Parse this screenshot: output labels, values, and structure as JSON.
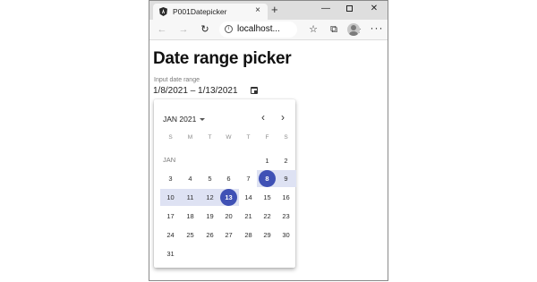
{
  "browser": {
    "tab_title": "P001Datepicker",
    "tab_close": "×",
    "new_tab": "+",
    "address": "localhost...",
    "icons": [
      "angular-icon",
      "back-icon",
      "forward-icon",
      "reload-icon",
      "info-icon",
      "star-icon",
      "favorites-icon",
      "collections-icon",
      "profile-icon",
      "more-icon",
      "minimize-icon",
      "maximize-icon",
      "close-icon"
    ]
  },
  "page": {
    "title": "Date range picker",
    "field_label": "Input date range",
    "field_value": "1/8/2021 – 1/13/2021"
  },
  "calendar": {
    "period": "JAN 2021",
    "month_label": "JAN",
    "weekdays": [
      "S",
      "M",
      "T",
      "W",
      "T",
      "F",
      "S"
    ],
    "days": [
      "1",
      "2",
      "3",
      "4",
      "5",
      "6",
      "7",
      "8",
      "9",
      "10",
      "11",
      "12",
      "13",
      "14",
      "15",
      "16",
      "17",
      "18",
      "19",
      "20",
      "21",
      "22",
      "23",
      "24",
      "25",
      "26",
      "27",
      "28",
      "29",
      "30",
      "31"
    ],
    "first_weekday_index": 5,
    "range_start": 8,
    "range_end": 13,
    "selected_color": "#3f51b5",
    "range_color": "#dee2f3"
  }
}
